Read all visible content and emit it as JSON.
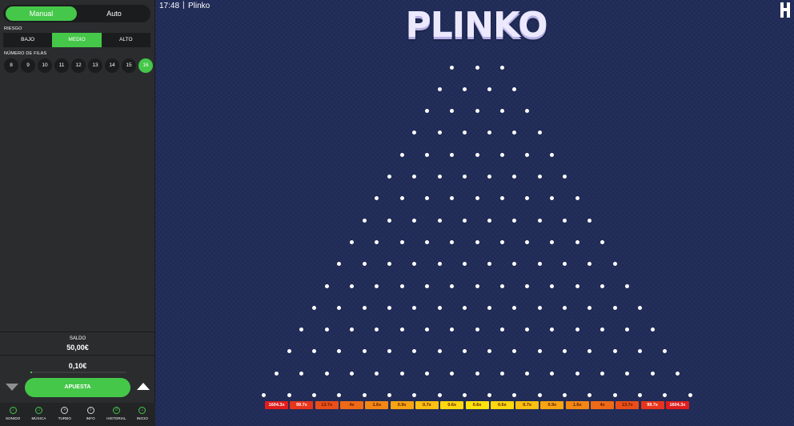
{
  "panel": {
    "mode": {
      "manual_label": "Manual",
      "auto_label": "Auto",
      "active": "manual"
    },
    "risk": {
      "label": "RIESGO",
      "options": [
        "BAJO",
        "MEDIO",
        "ALTO"
      ],
      "active": "MEDIO"
    },
    "rows": {
      "label": "NÚMERO DE FILAS",
      "options": [
        "8",
        "9",
        "10",
        "11",
        "12",
        "13",
        "14",
        "15",
        "16"
      ],
      "active": "16"
    },
    "balance": {
      "label": "SALDO",
      "value": "50,00€"
    },
    "stake": {
      "value": "0,10€",
      "level": 0.02
    },
    "bet_label": "APUESTA",
    "bottom_bar": [
      {
        "label": "SONIDO",
        "icon": "sound-icon"
      },
      {
        "label": "MÚSICA",
        "icon": "music-icon"
      },
      {
        "label": "TURBO",
        "icon": "turbo-icon"
      },
      {
        "label": "INFO",
        "icon": "info-icon"
      },
      {
        "label": "HISTORIAL",
        "icon": "history-icon"
      },
      {
        "label": "INICIO",
        "icon": "home-icon"
      }
    ]
  },
  "header": {
    "clock": "17:48",
    "separator": "|",
    "title": "Plinko"
  },
  "board": {
    "logo_text": "PLINKO",
    "multipliers": [
      "1604.3x",
      "99.7x",
      "13.7x",
      "4x",
      "1.6x",
      "0.9x",
      "0.7x",
      "0.6x",
      "0.6x",
      "0.6x",
      "0.7x",
      "0.9x",
      "1.6x",
      "4x",
      "13.7x",
      "99.7x",
      "1604.3x"
    ]
  },
  "colors": {
    "accent": "#45c74a",
    "board_bg": "#1f2a56",
    "panel_bg": "#2b2c2e"
  }
}
